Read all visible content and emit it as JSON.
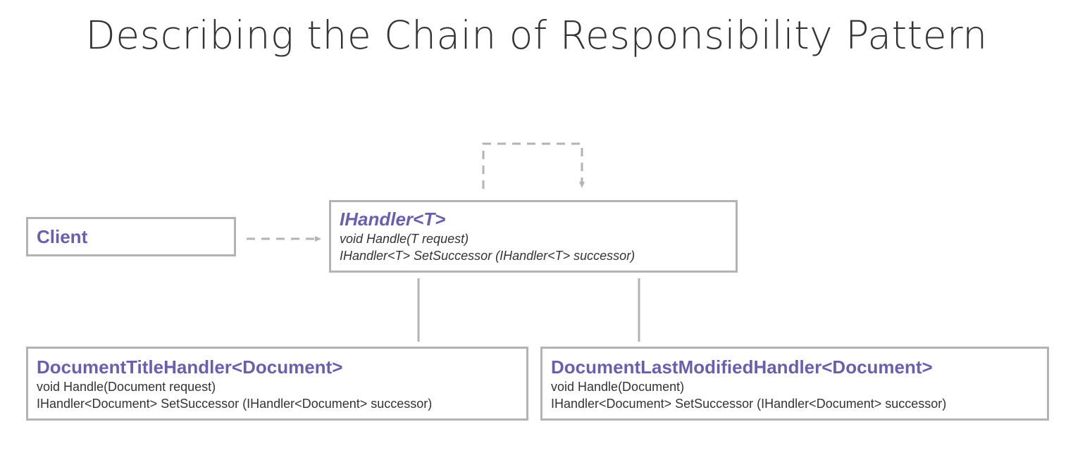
{
  "title": "Describing the Chain of Responsibility Pattern",
  "colors": {
    "class_name": "#6a5fae",
    "border": "#b3b3b3",
    "text": "#333333",
    "connector": "#b3b3b3"
  },
  "client": {
    "name": "Client"
  },
  "handler_interface": {
    "name": "IHandler<T>",
    "methods": [
      "void Handle(T request)",
      "IHandler<T> SetSuccessor (IHandler<T> successor)"
    ]
  },
  "document_title_handler": {
    "name": "DocumentTitleHandler<Document>",
    "methods": [
      "void Handle(Document request)",
      "IHandler<Document> SetSuccessor (IHandler<Document> successor)"
    ]
  },
  "document_last_modified_handler": {
    "name": "DocumentLastModifiedHandler<Document>",
    "methods": [
      "void Handle(Document)",
      "IHandler<Document> SetSuccessor (IHandler<Document> successor)"
    ]
  }
}
